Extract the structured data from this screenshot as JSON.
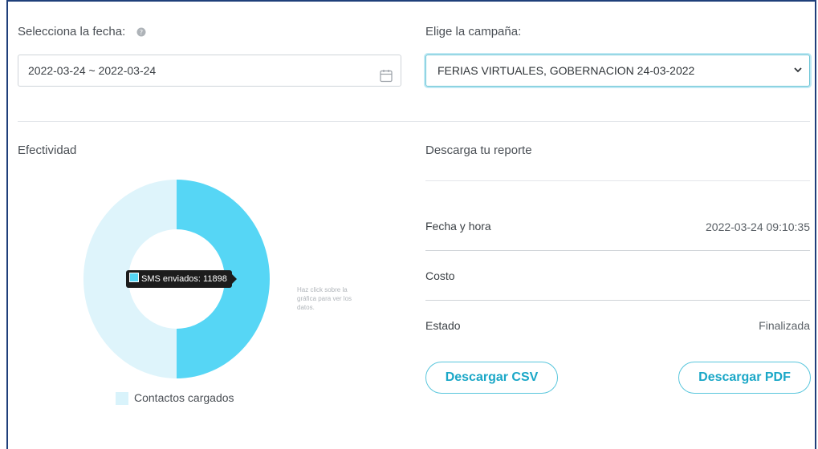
{
  "filters": {
    "date_label": "Selecciona la fecha:",
    "date_help_icon": "question-circle-icon",
    "date_value": "2022-03-24 ~ 2022-03-24",
    "calendar_icon": "calendar-icon",
    "campaign_label": "Elige la campaña:",
    "campaign_selected": "FERIAS VIRTUALES, GOBERNACION 24-03-2022",
    "chevron_icon": "chevron-down-icon"
  },
  "effectiveness": {
    "title": "Efectividad",
    "tooltip": "SMS enviados: 11898",
    "hint": "Haz click sobre la gráfica para ver los datos.",
    "legend": "Contactos cargados",
    "colors": {
      "sent": "#56d6f5",
      "loaded": "#def4fb"
    }
  },
  "chart_data": {
    "type": "pie",
    "donut": true,
    "slices": [
      {
        "label": "SMS enviados",
        "value": 11898,
        "color": "#56d6f5"
      },
      {
        "label": "Contactos cargados",
        "value": 11898,
        "color": "#def4fb"
      }
    ],
    "legend_entries": [
      "Contactos cargados"
    ],
    "legend_placement": "bottom"
  },
  "report": {
    "title": "Descarga tu reporte",
    "rows": [
      {
        "label": "Fecha y hora",
        "value": "2022-03-24 09:10:35"
      },
      {
        "label": "Costo",
        "value": ""
      },
      {
        "label": "Estado",
        "value": "Finalizada"
      }
    ],
    "csv_button": "Descargar CSV",
    "pdf_button": "Descargar PDF",
    "accent": "#1aa7c7"
  }
}
